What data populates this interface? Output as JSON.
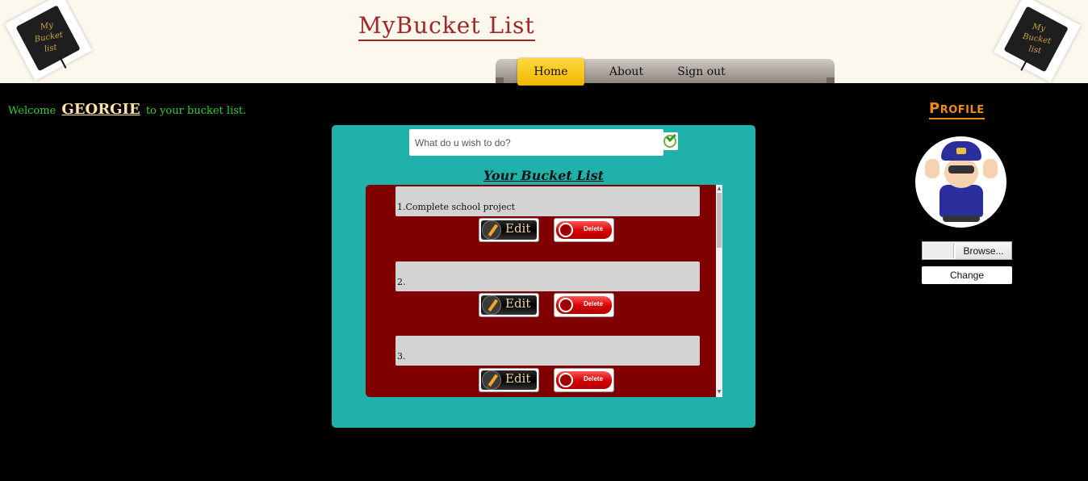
{
  "header": {
    "title": "MyBucket List",
    "logo_text": "My Bucket list"
  },
  "nav": {
    "items": [
      {
        "label": "Home",
        "active": true
      },
      {
        "label": "About",
        "active": false
      },
      {
        "label": "Sign out",
        "active": false
      }
    ]
  },
  "welcome": {
    "prefix": "Welcome",
    "username": "GEORGIE",
    "suffix": "to your bucket list."
  },
  "add_task": {
    "placeholder": "What do u wish to do?"
  },
  "bucket_list": {
    "heading": "Your Bucket List",
    "items": [
      {
        "text": "1.Complete school project",
        "edit_label": "Edit",
        "delete_label": "Delete"
      },
      {
        "text": "2.",
        "edit_label": "Edit",
        "delete_label": "Delete"
      },
      {
        "text": "3.",
        "edit_label": "Edit",
        "delete_label": "Delete"
      }
    ]
  },
  "profile": {
    "title": "Profile",
    "browse_label": "Browse...",
    "change_label": "Change"
  },
  "colors": {
    "panel": "#20b2aa",
    "list_bg": "#800000",
    "title": "#a22626",
    "welcome": "#2ecf2e",
    "profile_title": "#f08a16",
    "nav_active": "#f5c400"
  },
  "icons": {
    "add": "check-circle-icon",
    "edit": "pencil-icon",
    "delete": "delete-icon",
    "logo": "notebook-icon"
  }
}
